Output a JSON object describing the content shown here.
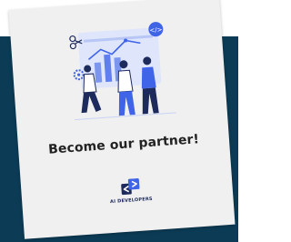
{
  "card": {
    "headline": "Become our partner!",
    "illustration_icon": "team-collaboration-illustration",
    "logo": {
      "icon": "code-brackets-logo-icon",
      "text": "AI DEVELOPERS"
    }
  },
  "colors": {
    "background_panel": "#0c3b55",
    "card": "#f0f0f0",
    "accent_blue": "#3f64e8",
    "navy": "#1d2a5c",
    "text": "#222222"
  }
}
